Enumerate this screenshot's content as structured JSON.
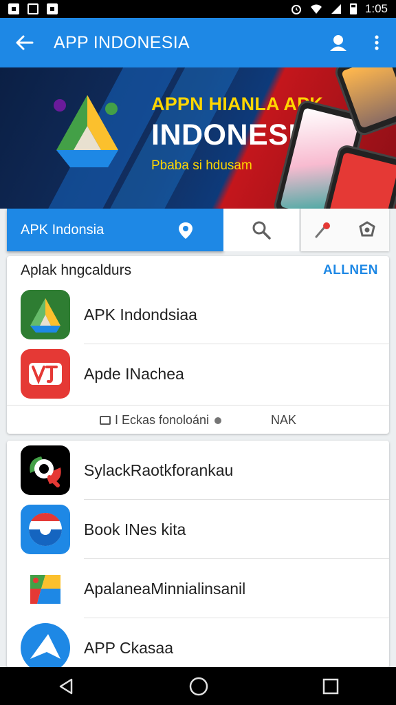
{
  "status_bar": {
    "time": "1:05"
  },
  "appbar": {
    "title": "APP INDONESIA"
  },
  "banner": {
    "headline": "APPN HIANLA APK",
    "headline_big": "INDONESIA",
    "subtitle": "Pbaba si hdusam"
  },
  "search": {
    "value": "APK Indonsia"
  },
  "section1": {
    "title": "Aplak hngcaldurs",
    "action": "ALLNEN",
    "items": [
      {
        "label": "APK Indondsiaa",
        "icon": "drive-like-icon"
      },
      {
        "label": "Apde INachea",
        "icon": "red-logo-icon"
      }
    ],
    "footer_left": "I Eckas fonoloáni",
    "footer_right": "NAK"
  },
  "section2": {
    "items": [
      {
        "label": "SylackRaotkforankau",
        "icon": "camera-app-icon"
      },
      {
        "label": "Book INes kita",
        "icon": "chrome-like-icon"
      },
      {
        "label": "ApalaneaMinnialinsanil",
        "icon": "maps-like-icon"
      },
      {
        "label": "APP Ckasaa",
        "icon": "arrow-app-icon"
      }
    ]
  },
  "colors": {
    "primary": "#1e88e5",
    "accent_yellow": "#ffd600"
  }
}
